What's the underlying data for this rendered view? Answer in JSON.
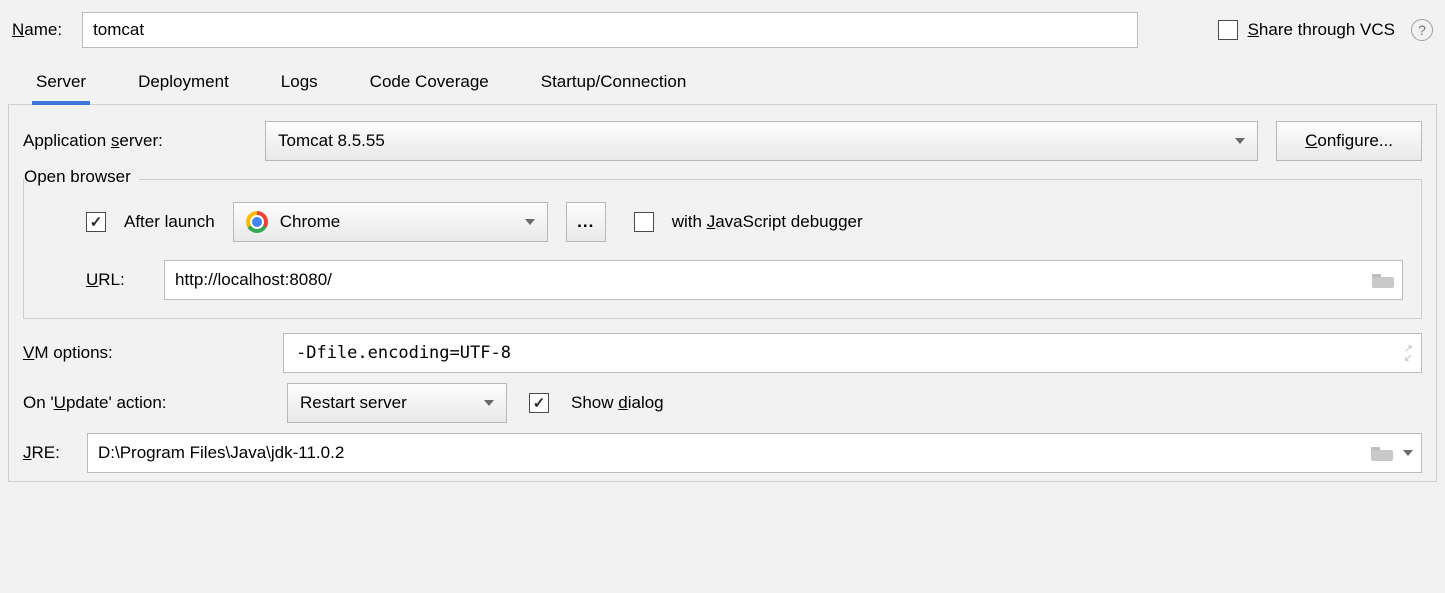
{
  "top": {
    "name_label_pre": "N",
    "name_label_post": "ame:",
    "name_value": "tomcat",
    "share_pre": "S",
    "share_post": "hare through VCS",
    "help_glyph": "?"
  },
  "tabs": {
    "server": "Server",
    "deployment": "Deployment",
    "logs": "Logs",
    "coverage": "Code Coverage",
    "startup": "Startup/Connection"
  },
  "server": {
    "app_server_label_pre": "Application ",
    "app_server_label_u": "s",
    "app_server_label_post": "erver:",
    "app_server_value": "Tomcat 8.5.55",
    "configure_u": "C",
    "configure_post": "onfigure...",
    "open_browser_legend": "Open browser",
    "after_launch": "After launch",
    "browser_value": "Chrome",
    "ellipsis": "...",
    "with_js_pre": "with ",
    "with_js_u": "J",
    "with_js_post": "avaScript debugger",
    "url_u": "U",
    "url_post": "RL:",
    "url_value": "http://localhost:8080/",
    "vm_u": "V",
    "vm_post": "M options:",
    "vm_value": "-Dfile.encoding=UTF-8",
    "on_update_pre": "On '",
    "on_update_u": "U",
    "on_update_post": "pdate' action:",
    "update_value": "Restart server",
    "show_dialog_pre": "Show ",
    "show_dialog_u": "d",
    "show_dialog_post": "ialog",
    "jre_u": "J",
    "jre_post": "RE:",
    "jre_value": "D:\\Program Files\\Java\\jdk-11.0.2"
  }
}
